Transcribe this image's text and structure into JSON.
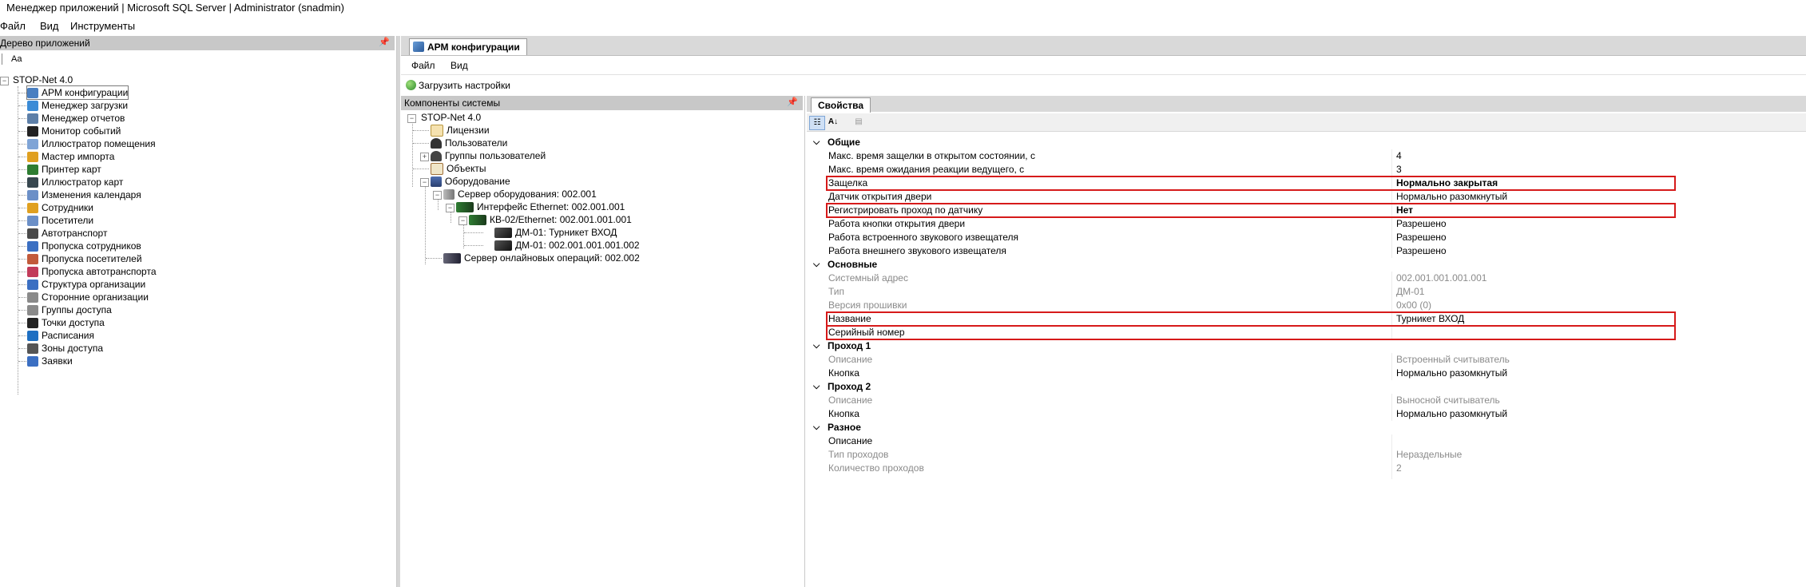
{
  "window": {
    "title": "Менеджер приложений | Microsoft SQL Server | Administrator  (snadmin)"
  },
  "menu": {
    "file": "Файл",
    "view": "Вид",
    "tools": "Инструменты"
  },
  "left_panel": {
    "header": "Дерево приложений",
    "toolbar_label": "Aa",
    "root": "STOP-Net 4.0",
    "items": [
      {
        "label": "АРМ конфигурации",
        "icon": "config-icon",
        "color": "#4a7fc1"
      },
      {
        "label": "Менеджер загрузки",
        "icon": "download-manager-icon",
        "color": "#3b8bd6"
      },
      {
        "label": "Менеджер отчетов",
        "icon": "report-icon",
        "color": "#5d7fa8"
      },
      {
        "label": "Монитор событий",
        "icon": "monitor-icon",
        "color": "#222222"
      },
      {
        "label": "Иллюстратор помещения",
        "icon": "room-illustrator-icon",
        "color": "#7fa4d6"
      },
      {
        "label": "Мастер импорта",
        "icon": "import-wizard-icon",
        "color": "#e0a020"
      },
      {
        "label": "Принтер карт",
        "icon": "card-printer-icon",
        "color": "#2e7d32"
      },
      {
        "label": "Иллюстратор карт",
        "icon": "card-illustrator-icon",
        "color": "#37474f"
      },
      {
        "label": "Изменения календаря",
        "icon": "calendar-icon",
        "color": "#6b8fc7"
      },
      {
        "label": "Сотрудники",
        "icon": "employees-icon",
        "color": "#e0a020"
      },
      {
        "label": "Посетители",
        "icon": "visitors-icon",
        "color": "#6b8fc7"
      },
      {
        "label": "Автотранспорт",
        "icon": "vehicle-icon",
        "color": "#4a4a4a"
      },
      {
        "label": "Пропуска сотрудников",
        "icon": "employee-pass-icon",
        "color": "#3b6fc2"
      },
      {
        "label": "Пропуска посетителей",
        "icon": "visitor-pass-icon",
        "color": "#c25a3b"
      },
      {
        "label": "Пропуска автотранспорта",
        "icon": "vehicle-pass-icon",
        "color": "#c23b5a"
      },
      {
        "label": "Структура организации",
        "icon": "org-structure-icon",
        "color": "#3b6fc2"
      },
      {
        "label": "Сторонние организации",
        "icon": "third-party-org-icon",
        "color": "#8a8a8a"
      },
      {
        "label": "Группы доступа",
        "icon": "access-groups-icon",
        "color": "#8a8a8a"
      },
      {
        "label": "Точки доступа",
        "icon": "access-points-icon",
        "color": "#222222"
      },
      {
        "label": "Расписания",
        "icon": "schedule-icon",
        "color": "#1e6fc2"
      },
      {
        "label": "Зоны доступа",
        "icon": "access-zones-icon",
        "color": "#555555"
      },
      {
        "label": "Заявки",
        "icon": "requests-icon",
        "color": "#3b6fc2"
      }
    ]
  },
  "document_tab": {
    "label": "АРМ конфигурации"
  },
  "inner_menu": {
    "file": "Файл",
    "view": "Вид"
  },
  "load_settings": "Загрузить настройки",
  "components": {
    "header": "Компоненты системы",
    "root": "STOP-Net 4.0",
    "licenses": "Лицензии",
    "users": "Пользователи",
    "user_groups": "Группы пользователей",
    "objects": "Объекты",
    "equipment": "Оборудование",
    "hw_server": "Сервер оборудования: 002.001",
    "eth_interface": "Интерфейс Ethernet: 002.001.001",
    "kv02": "КВ-02/Ethernet: 002.001.001.001",
    "dm01_a": "ДМ-01: Турникет ВХОД",
    "dm01_b": "ДМ-01: 002.001.001.001.002",
    "online_server": "Сервер онлайновых операций: 002.002"
  },
  "properties": {
    "tab": "Свойства",
    "toolbar": {
      "categorized": "categorized-icon",
      "alphabetical": "А↓Я",
      "pages": "property-pages-icon"
    },
    "categories": [
      {
        "name": "Общие",
        "rows": [
          {
            "key": "Макс. время защелки в открытом состоянии, с",
            "value": "4"
          },
          {
            "key": "Макс. время ожидания реакции ведущего, с",
            "value": "3"
          },
          {
            "key": "Защелка",
            "value": "Нормально закрытая"
          },
          {
            "key": "Датчик открытия двери",
            "value": "Нормально разомкнутый"
          },
          {
            "key": "Регистрировать проход по датчику",
            "value": "Нет"
          },
          {
            "key": "Работа кнопки открытия двери",
            "value": "Разрешено"
          },
          {
            "key": "Работа встроенного звукового извещателя",
            "value": "Разрешено"
          },
          {
            "key": "Работа внешнего звукового извещателя",
            "value": "Разрешено"
          }
        ]
      },
      {
        "name": "Основные",
        "rows": [
          {
            "key": "Системный адрес",
            "value": "002.001.001.001.001"
          },
          {
            "key": "Тип",
            "value": "ДМ-01"
          },
          {
            "key": "Версия прошивки",
            "value": "0x00 (0)"
          },
          {
            "key": "Название",
            "value": "Турникет ВХОД"
          },
          {
            "key": "Серийный номер",
            "value": ""
          }
        ]
      },
      {
        "name": "Проход 1",
        "rows": [
          {
            "key": "Описание",
            "value": "Встроенный считыватель"
          },
          {
            "key": "Кнопка",
            "value": "Нормально разомкнутый"
          }
        ]
      },
      {
        "name": "Проход 2",
        "rows": [
          {
            "key": "Описание",
            "value": "Выносной считыватель"
          },
          {
            "key": "Кнопка",
            "value": "Нормально разомкнутый"
          }
        ]
      },
      {
        "name": "Разное",
        "rows": [
          {
            "key": "Описание",
            "value": ""
          },
          {
            "key": "Тип проходов",
            "value": "Нераздельные"
          },
          {
            "key": "Количество проходов",
            "value": "2"
          }
        ]
      }
    ]
  },
  "colors": {
    "highlight": "#d61a1a",
    "panel_header": "#c8c8c8",
    "dim_text": "#8a8a8a"
  }
}
